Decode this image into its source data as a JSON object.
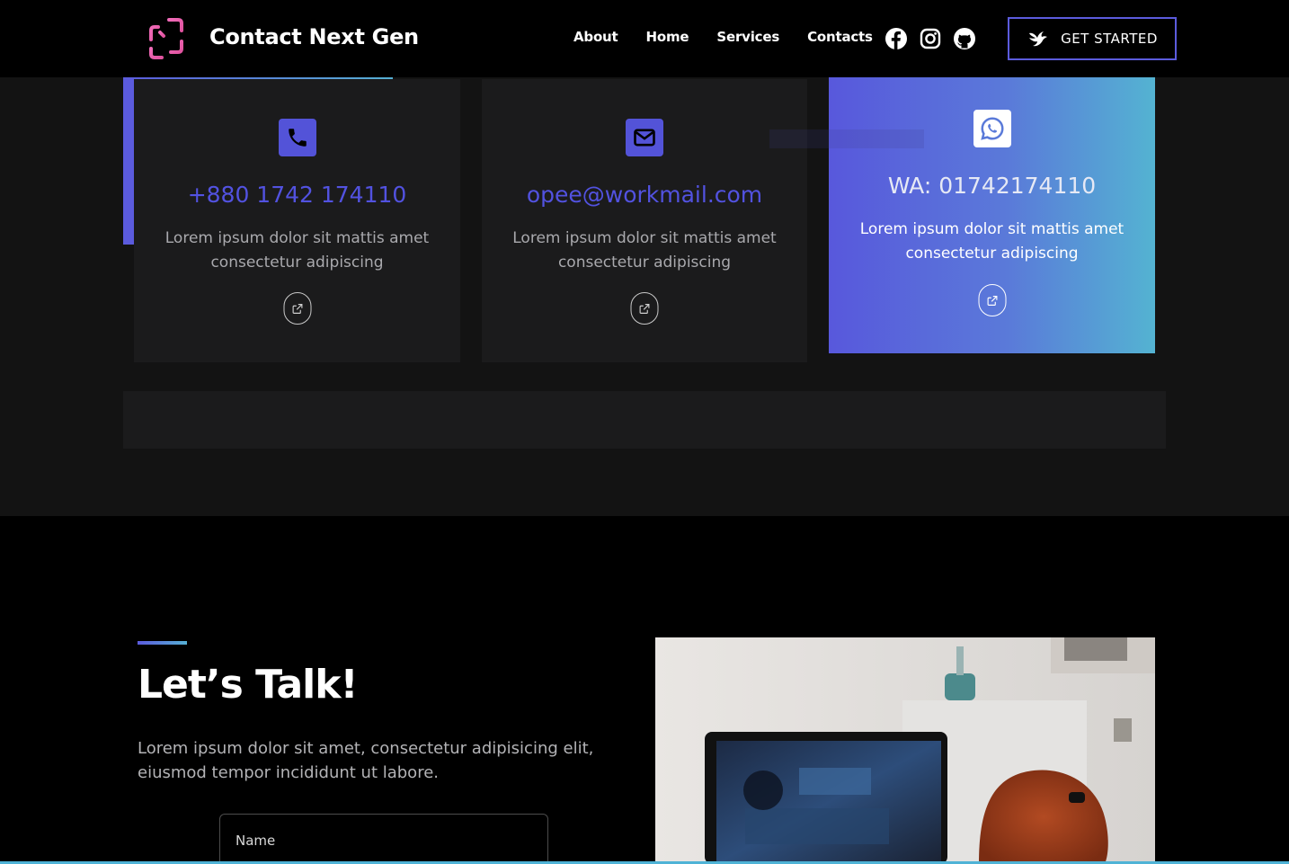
{
  "header": {
    "brand": "Contact Next Gen",
    "nav": [
      {
        "label": "About"
      },
      {
        "label": "Home"
      },
      {
        "label": "Services"
      },
      {
        "label": "Contacts"
      }
    ],
    "social_icons": [
      "facebook-icon",
      "instagram-icon",
      "github-icon"
    ],
    "cta_label": "GET STARTED"
  },
  "cards": [
    {
      "icon": "phone-icon",
      "title": "+880 1742 174110",
      "description": "Lorem ipsum dolor sit mattis amet consectetur adipiscing"
    },
    {
      "icon": "envelope-icon",
      "title": "opee@workmail.com",
      "description": "Lorem ipsum dolor sit mattis amet consectetur adipiscing"
    },
    {
      "icon": "whatsapp-icon",
      "title": "WA: 01742174110",
      "description": "Lorem ipsum dolor sit mattis amet consectetur adipiscing"
    }
  ],
  "talk": {
    "title": "Let’s Talk!",
    "description": "Lorem ipsum dolor sit amet, consectetur adipisicing elit, eiusmod tempor incididunt ut labore.",
    "name_placeholder": "Name"
  },
  "colors": {
    "accent": "#5b5bdd",
    "accent_secondary": "#56b0d4",
    "logo_pink": "#ef5fb3",
    "background": "#000000",
    "panel": "#1b1b1c"
  }
}
